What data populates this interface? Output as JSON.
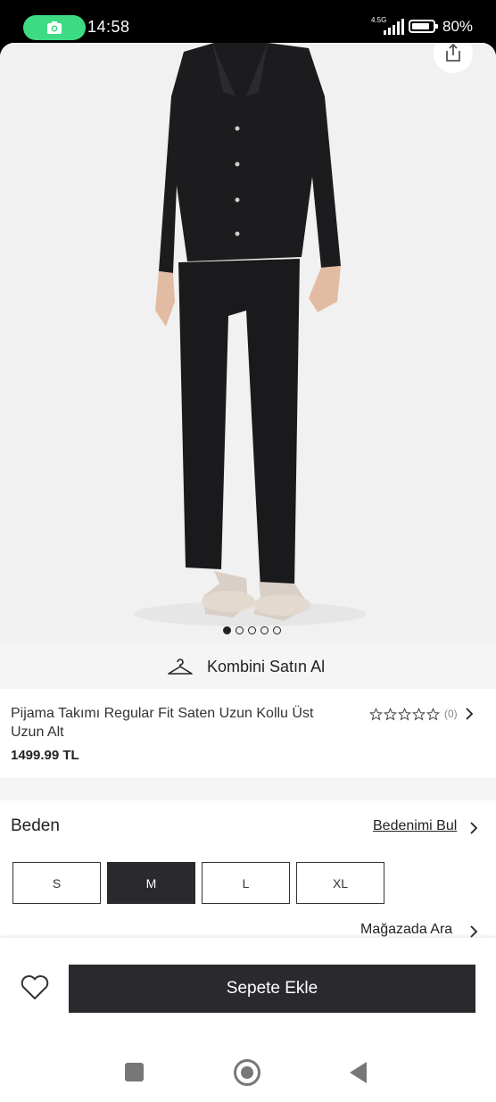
{
  "status_bar": {
    "time": "14:58",
    "network": "4.5G",
    "battery": "80%",
    "icons": [
      "camera-icon",
      "signal-icon",
      "battery-icon"
    ]
  },
  "gallery": {
    "image_description": "model-wearing-black-satin-pajama-set",
    "slide_count": 5,
    "active_slide": 1,
    "share_icon": "share-icon"
  },
  "combo": {
    "label": "Kombini Satın Al",
    "icon": "hanger-icon"
  },
  "product": {
    "title": "Pijama Takımı Regular Fit Saten Uzun Kollu Üst Uzun Alt",
    "price": "1499.99 TL",
    "rating_stars": 0,
    "review_count": "(0)"
  },
  "size": {
    "heading": "Beden",
    "find_size_label": "Bedenimi Bul",
    "options": [
      "S",
      "M",
      "L",
      "XL"
    ],
    "selected": "M",
    "store_search_label": "Mağazada Ara"
  },
  "actions": {
    "add_to_cart_label": "Sepete Ekle",
    "favorite_icon": "heart-icon"
  },
  "colors": {
    "primary_dark": "#2a2a2e",
    "status_green": "#3ddc84",
    "page_bg": "#f5f5f5"
  }
}
